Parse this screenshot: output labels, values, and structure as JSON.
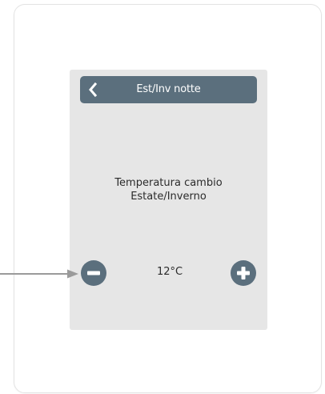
{
  "header": {
    "title": "Est/Inv notte",
    "back_icon": "chevron-left-icon"
  },
  "setting": {
    "line1": "Temperatura cambio",
    "line2": "Estate/Inverno"
  },
  "control": {
    "value": "12°C",
    "decrease_icon": "minus-icon",
    "increase_icon": "plus-icon"
  },
  "colors": {
    "header_bg": "#5b6f7d",
    "screen_bg": "#e6e6e6",
    "button_bg": "#5b6f7d",
    "pointer_arrow": "#9a9a9a"
  }
}
